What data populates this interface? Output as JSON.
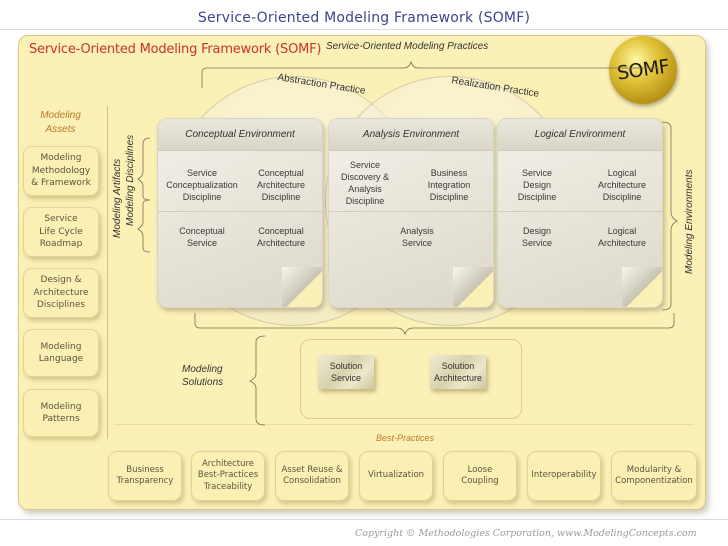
{
  "page_title": "Service-Oriented Modeling Framework (SOMF)",
  "panel": {
    "title": "Service-Oriented Modeling Framework (SOMF)",
    "practices_label": "Service-Oriented Modeling Practices",
    "logo_text": "SOMF",
    "practices": [
      {
        "label": "Abstraction Practice"
      },
      {
        "label": "Realization Practice"
      }
    ],
    "modeling_environments_label": "Modeling Environments"
  },
  "assets": {
    "title_line1": "Modeling",
    "title_line2": "Assets",
    "items": [
      {
        "label": "Modeling Methodology & Framework"
      },
      {
        "label": "Service Life Cycle Roadmap"
      },
      {
        "label": "Design & Architecture Disciplines"
      },
      {
        "label": "Modeling Language"
      },
      {
        "label": "Modeling Patterns"
      }
    ]
  },
  "row_labels": {
    "disciplines": "Modeling  Disciplines",
    "artifacts": "Modeling  Artifacts"
  },
  "environments": [
    {
      "title": "Conceptual Environment",
      "disciplines": [
        "Service Conceptualization Discipline",
        "Conceptual Architecture Discipline"
      ],
      "artifacts": [
        "Conceptual Service",
        "Conceptual Architecture"
      ]
    },
    {
      "title": "Analysis Environment",
      "disciplines": [
        "Service Discovery & Analysis Discipline",
        "Business Integration Discipline"
      ],
      "artifacts": [
        "Analysis Service"
      ]
    },
    {
      "title": "Logical Environment",
      "disciplines": [
        "Service Design Discipline",
        "Logical Architecture Discipline"
      ],
      "artifacts": [
        "Design Service",
        "Logical Architecture"
      ]
    }
  ],
  "solutions": {
    "label_line1": "Modeling",
    "label_line2": "Solutions",
    "items": [
      {
        "label": "Solution Service"
      },
      {
        "label": "Solution Architecture"
      }
    ]
  },
  "best_practices": {
    "label": "Best-Practices",
    "items": [
      {
        "label": "Business Transparency"
      },
      {
        "label": "Architecture Best-Practices Traceability"
      },
      {
        "label": "Asset Reuse & Consolidation"
      },
      {
        "label": "Virtualization"
      },
      {
        "label": "Loose Coupling"
      },
      {
        "label": "Interoperability"
      },
      {
        "label": "Modularity & Componentization"
      }
    ]
  },
  "copyright": "Copyright © Methodologies Corporation, www.ModelingConcepts.com"
}
